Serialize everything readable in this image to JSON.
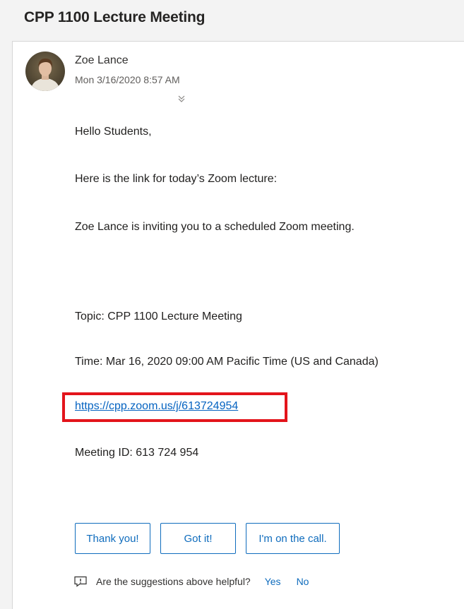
{
  "message": {
    "subject": "CPP 1100 Lecture Meeting",
    "sender": {
      "name": "Zoe Lance",
      "date": "Mon 3/16/2020 8:57 AM",
      "avatar_icon": "user-photo"
    },
    "body": {
      "greeting": "Hello Students,",
      "intro": "Here is the link for today’s Zoom lecture:",
      "invitation": "Zoe Lance is inviting you to a scheduled Zoom meeting.",
      "topic": "Topic: CPP 1100 Lecture Meeting",
      "time": "Time: Mar 16, 2020 09:00 AM Pacific Time (US and Canada)",
      "link": "https://cpp.zoom.us/j/613724954",
      "meeting_id": "Meeting ID: 613 724 954"
    },
    "highlight_color": "#e3141b",
    "link_color": "#0563c1"
  },
  "suggested_replies": [
    "Thank you!",
    "Got it!",
    "I'm on the call."
  ],
  "feedback": {
    "question": "Are the suggestions above helpful?",
    "yes": "Yes",
    "no": "No",
    "icon": "feedback-icon"
  },
  "accent_color": "#0f6cbd"
}
